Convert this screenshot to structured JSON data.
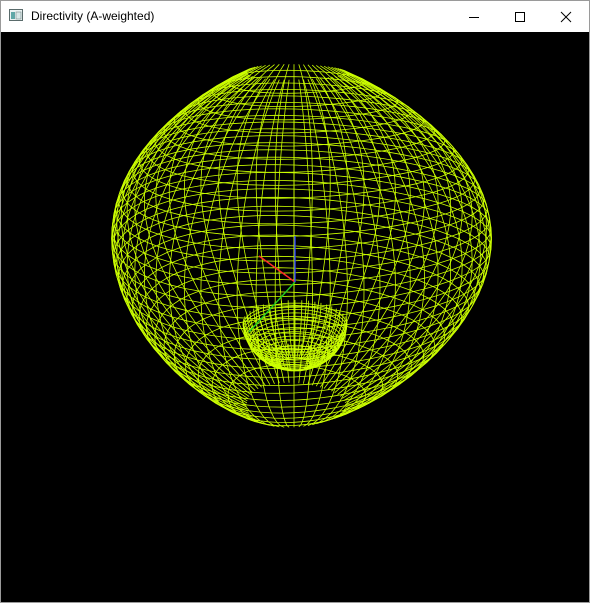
{
  "window": {
    "title": "Directivity (A-weighted)",
    "controls": {
      "minimize": "minimize",
      "maximize": "maximize",
      "close": "close"
    }
  },
  "viewport": {
    "background": "#000000",
    "mesh_color": "#ccff00",
    "axes": {
      "x_color": "#ff2a2a",
      "y_color": "#22cc22",
      "z_color": "#2a3dff"
    },
    "content": "wireframe directivity balloon"
  }
}
